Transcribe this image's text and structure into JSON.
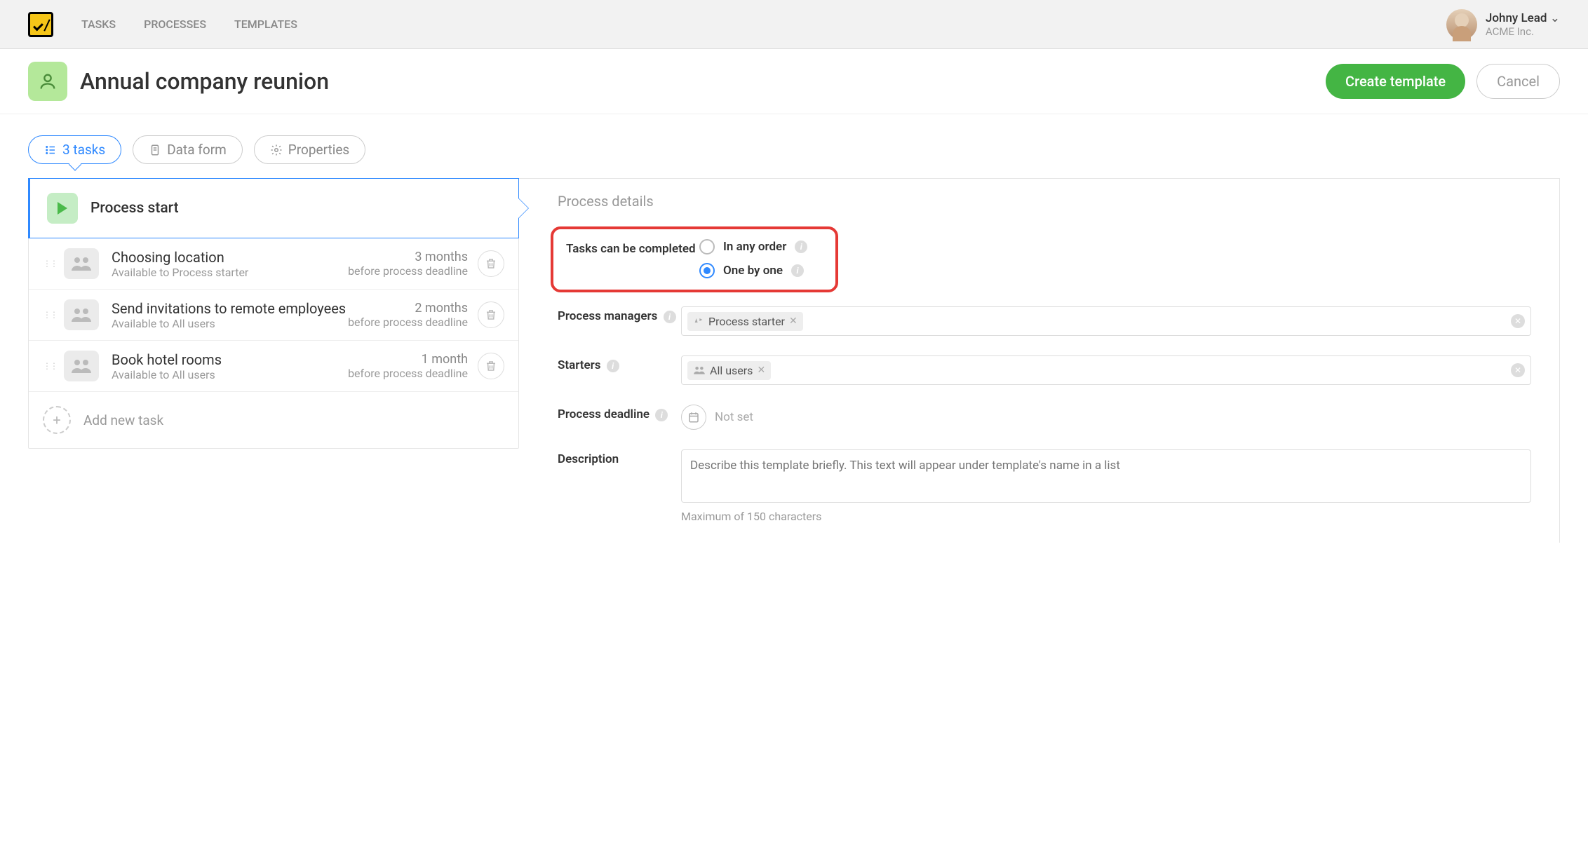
{
  "nav": {
    "tasks": "TASKS",
    "processes": "PROCESSES",
    "templates": "TEMPLATES"
  },
  "user": {
    "name": "Johny Lead",
    "org": "ACME Inc."
  },
  "header": {
    "title": "Annual company reunion",
    "create": "Create template",
    "cancel": "Cancel"
  },
  "tabs": {
    "tasks": "3 tasks",
    "dataform": "Data form",
    "properties": "Properties"
  },
  "process_start": "Process start",
  "tasks_list": [
    {
      "title": "Choosing location",
      "sub": "Available to Process starter",
      "dl_top": "3 months",
      "dl_bot": "before process deadline"
    },
    {
      "title": "Send invitations to remote employees",
      "sub": "Available to All users",
      "dl_top": "2 months",
      "dl_bot": "before process deadline"
    },
    {
      "title": "Book hotel rooms",
      "sub": "Available to All users",
      "dl_top": "1 month",
      "dl_bot": "before process deadline"
    }
  ],
  "add_task": "Add new task",
  "details": {
    "heading": "Process details",
    "completion_label": "Tasks can be completed",
    "completion_opts": {
      "any": "In any order",
      "seq": "One by one"
    },
    "managers_label": "Process managers",
    "managers_tag": "Process starter",
    "starters_label": "Starters",
    "starters_tag": "All users",
    "deadline_label": "Process deadline",
    "deadline_value": "Not set",
    "description_label": "Description",
    "description_placeholder": "Describe this template briefly. This text will appear under template's name in a list",
    "description_hint": "Maximum of 150 characters"
  }
}
